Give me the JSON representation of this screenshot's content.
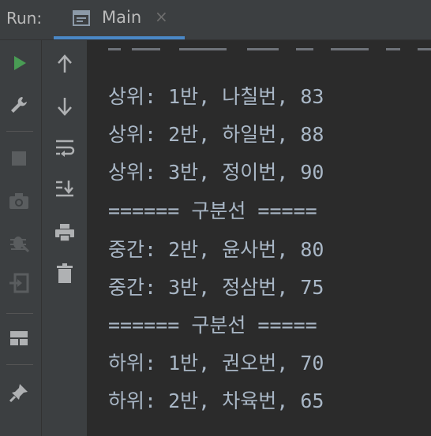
{
  "header": {
    "run_label": "Run:",
    "tab": {
      "title": "Main",
      "close": "×"
    }
  },
  "sidebar": {
    "left_tools": [
      {
        "name": "rerun-icon",
        "color": "#499c54",
        "enabled": true
      },
      {
        "name": "wrench-icon",
        "color": "#afb1b3",
        "enabled": true
      },
      {
        "name": "stop-icon",
        "color": "#5a5d5f",
        "enabled": false
      },
      {
        "name": "camera-icon",
        "color": "#5a5d5f",
        "enabled": false
      },
      {
        "name": "debug-bug-icon",
        "color": "#5a5d5f",
        "enabled": false
      },
      {
        "name": "exit-icon",
        "color": "#5a5d5f",
        "enabled": false
      },
      {
        "name": "layout-icon",
        "color": "#afb1b3",
        "enabled": true
      },
      {
        "name": "pin-icon",
        "color": "#afb1b3",
        "enabled": true
      }
    ],
    "right_tools": [
      {
        "name": "up-arrow-icon"
      },
      {
        "name": "down-arrow-icon"
      },
      {
        "name": "soft-wrap-icon"
      },
      {
        "name": "scroll-to-end-icon"
      },
      {
        "name": "print-icon"
      },
      {
        "name": "trash-icon"
      }
    ]
  },
  "console": {
    "lines": [
      "상위: 1반, 나칠번, 83",
      "상위: 2반, 하일번, 88",
      "상위: 3반, 정이번, 90",
      "====== 구분선 =====",
      "중간: 2반, 윤사번, 80",
      "중간: 3반, 정삼번, 75",
      "====== 구분선 =====",
      "하위: 1반, 권오번, 70",
      "하위: 2반, 차육번, 65"
    ]
  }
}
